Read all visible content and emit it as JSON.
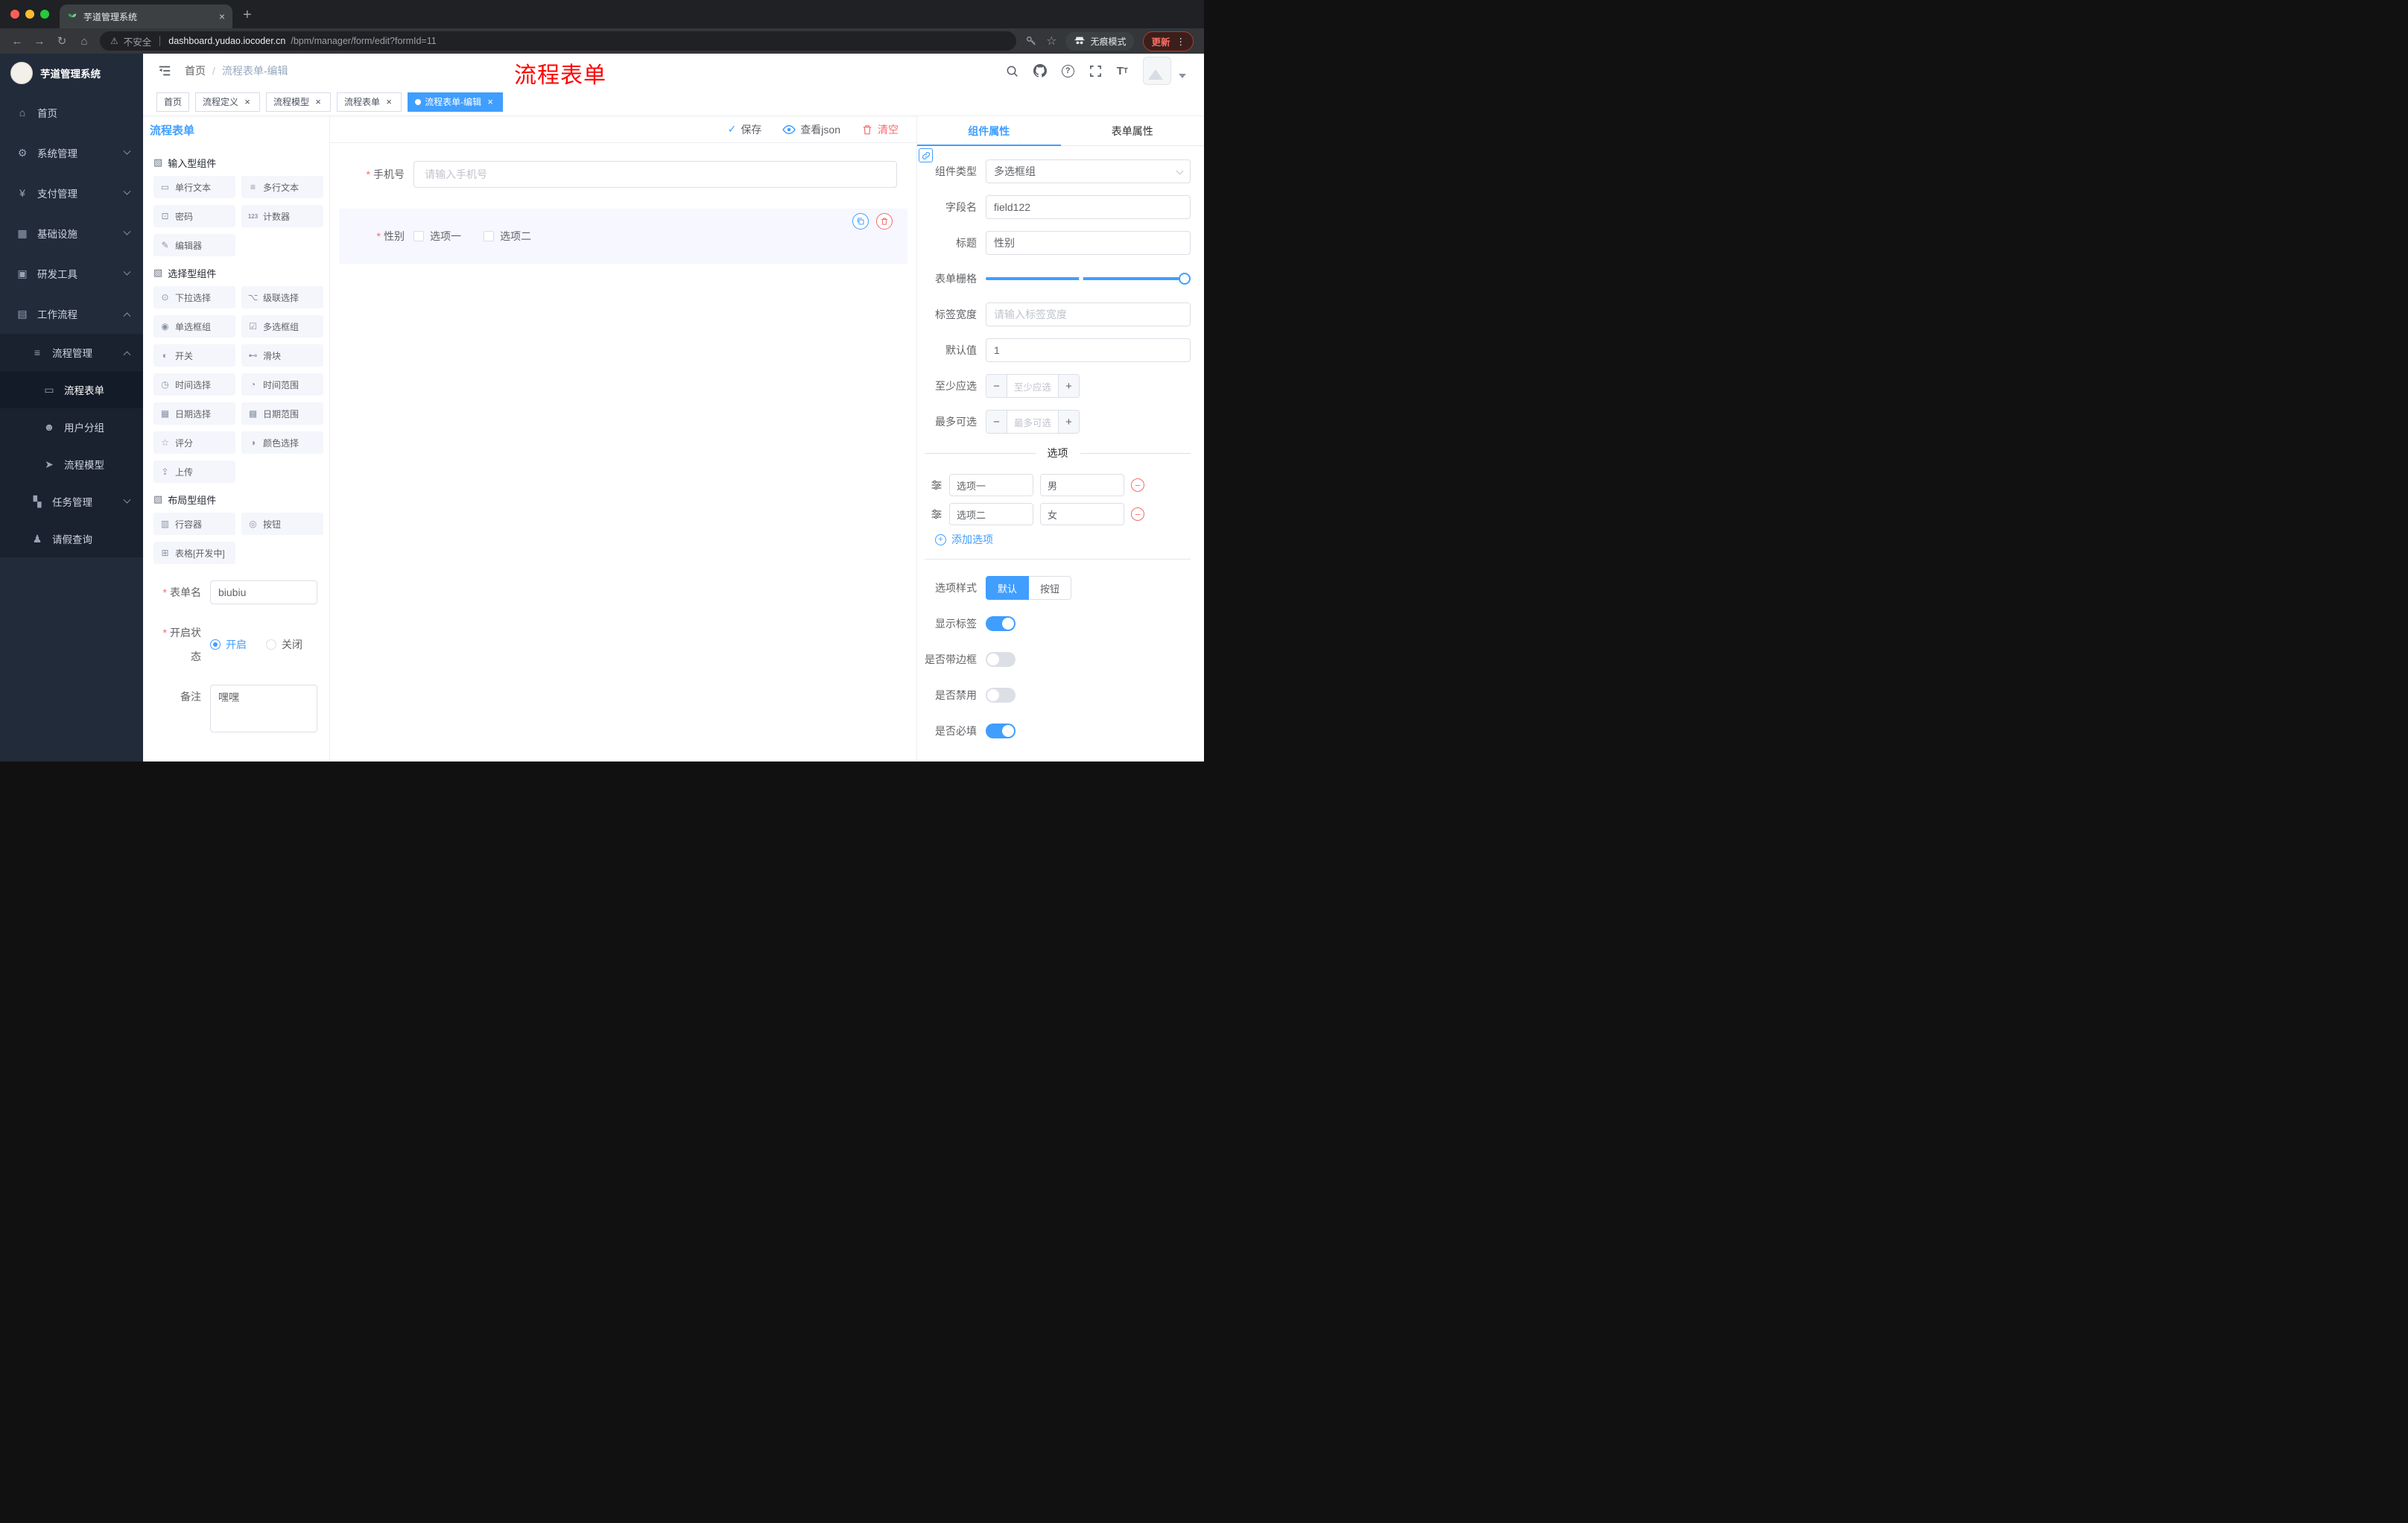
{
  "colors": {
    "accent": "#409eff",
    "danger": "#f56c6c"
  },
  "browser": {
    "tab_title": "芋道管理系统",
    "security_label": "不安全",
    "url_domain": "dashboard.yudao.iocoder.cn",
    "url_path": "/bpm/manager/form/edit?formId=11",
    "incognito_label": "无痕模式",
    "update_label": "更新"
  },
  "sidebar": {
    "logo_title": "芋道管理系统",
    "items": [
      {
        "label": "首页"
      },
      {
        "label": "系统管理"
      },
      {
        "label": "支付管理"
      },
      {
        "label": "基础设施"
      },
      {
        "label": "研发工具"
      },
      {
        "label": "工作流程"
      },
      {
        "label": "流程管理"
      },
      {
        "label": "流程表单"
      },
      {
        "label": "用户分组"
      },
      {
        "label": "流程模型"
      },
      {
        "label": "任务管理"
      },
      {
        "label": "请假查询"
      }
    ]
  },
  "header": {
    "breadcrumb_home": "首页",
    "breadcrumb_current": "流程表单-编辑",
    "annotation": "流程表单"
  },
  "tags": [
    {
      "label": "首页"
    },
    {
      "label": "流程定义"
    },
    {
      "label": "流程模型"
    },
    {
      "label": "流程表单"
    },
    {
      "label": "流程表单-编辑"
    }
  ],
  "designer": {
    "panel_title": "流程表单",
    "toolbar": {
      "save": "保存",
      "view_json": "查看json",
      "clear": "清空"
    },
    "groups": [
      {
        "title": "输入型组件",
        "items": [
          "单行文本",
          "多行文本",
          "密码",
          "计数器",
          "编辑器"
        ]
      },
      {
        "title": "选择型组件",
        "items": [
          "下拉选择",
          "级联选择",
          "单选框组",
          "多选框组",
          "开关",
          "滑块",
          "时间选择",
          "时间范围",
          "日期选择",
          "日期范围",
          "评分",
          "颜色选择",
          "上传"
        ]
      },
      {
        "title": "布局型组件",
        "items": [
          "行容器",
          "按钮",
          "表格[开发中]"
        ]
      }
    ],
    "meta": {
      "form_name_label": "表单名",
      "form_name_value": "biubiu",
      "status_label": "开启状态",
      "status_on": "开启",
      "status_off": "关闭",
      "remark_label": "备注",
      "remark_value": "嘿嘿"
    }
  },
  "canvas": {
    "phone_label": "手机号",
    "phone_placeholder": "请输入手机号",
    "gender_label": "性别",
    "gender_option1": "选项一",
    "gender_option2": "选项二"
  },
  "props": {
    "tab_component": "组件属性",
    "tab_form": "表单属性",
    "component_type_label": "组件类型",
    "component_type_value": "多选框组",
    "field_name_label": "字段名",
    "field_name_value": "field122",
    "title_label": "标题",
    "title_value": "性别",
    "grid_label": "表单栅格",
    "label_width_label": "标签宽度",
    "label_width_placeholder": "请输入标签宽度",
    "default_label": "默认值",
    "default_value": "1",
    "min_label": "至少应选",
    "min_placeholder": "至少应选",
    "max_label": "最多可选",
    "max_placeholder": "最多可选",
    "options_title": "选项",
    "options": [
      {
        "label": "选项一",
        "value": "男"
      },
      {
        "label": "选项二",
        "value": "女"
      }
    ],
    "add_option": "添加选项",
    "style_label": "选项样式",
    "style_default": "默认",
    "style_button": "按钮",
    "switch_show_label": "显示标签",
    "switch_border": "是否带边框",
    "switch_disabled": "是否禁用",
    "switch_required": "是否必填"
  }
}
